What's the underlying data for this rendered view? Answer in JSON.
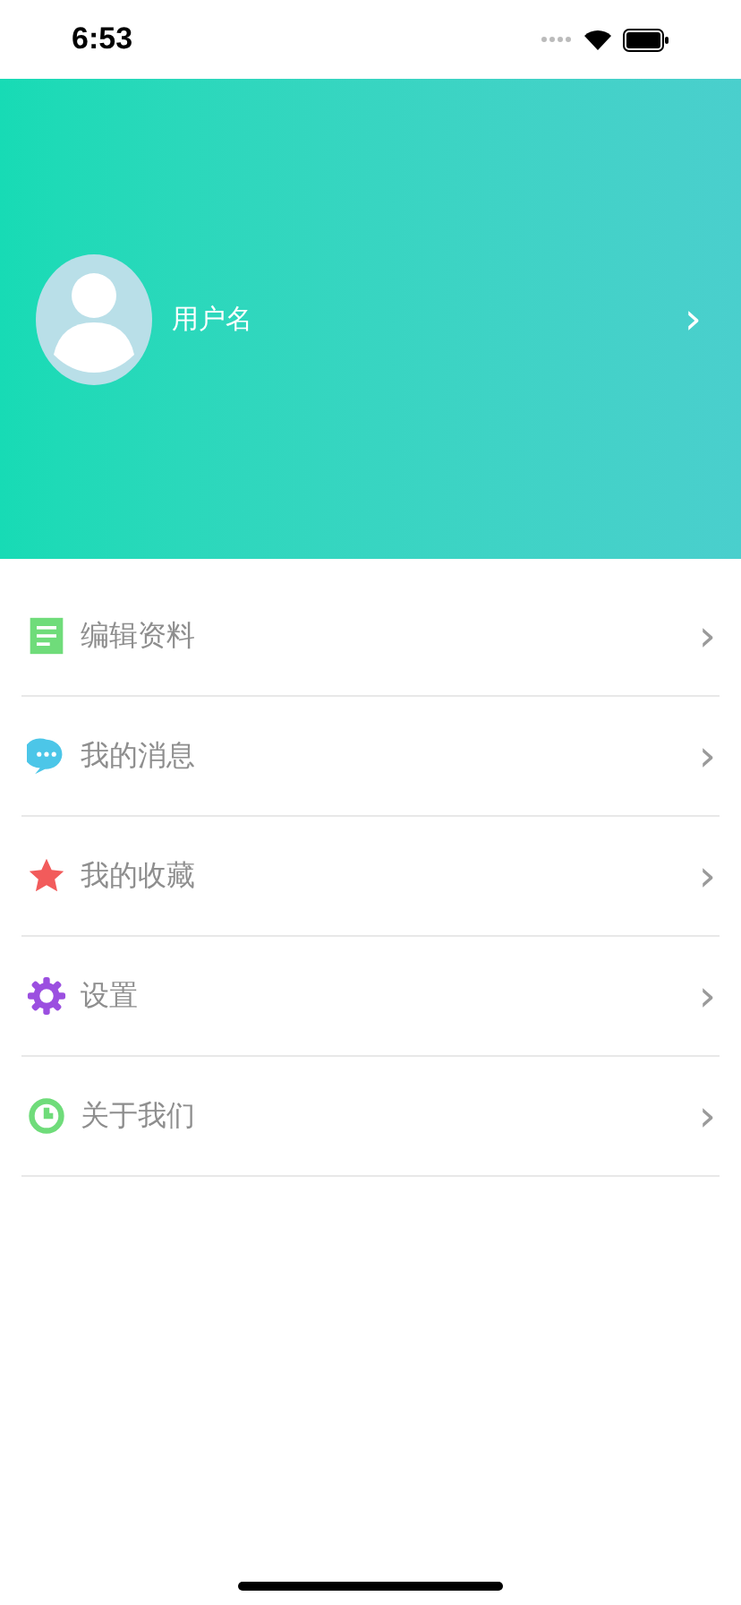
{
  "status_bar": {
    "time": "6:53"
  },
  "profile": {
    "username": "用户名",
    "chevron": "›"
  },
  "menu": [
    {
      "kind": "document",
      "label": "编辑资料",
      "color": "#6fdc7a",
      "chevron": "›"
    },
    {
      "kind": "message",
      "label": "我的消息",
      "color": "#4cc6e8",
      "chevron": "›"
    },
    {
      "kind": "star",
      "label": "我的收藏",
      "color": "#f25b5b",
      "chevron": "›"
    },
    {
      "kind": "gear",
      "label": "设置",
      "color": "#9b4fe0",
      "chevron": "›"
    },
    {
      "kind": "about",
      "label": "关于我们",
      "color": "#6fdc7a",
      "chevron": "›"
    }
  ]
}
